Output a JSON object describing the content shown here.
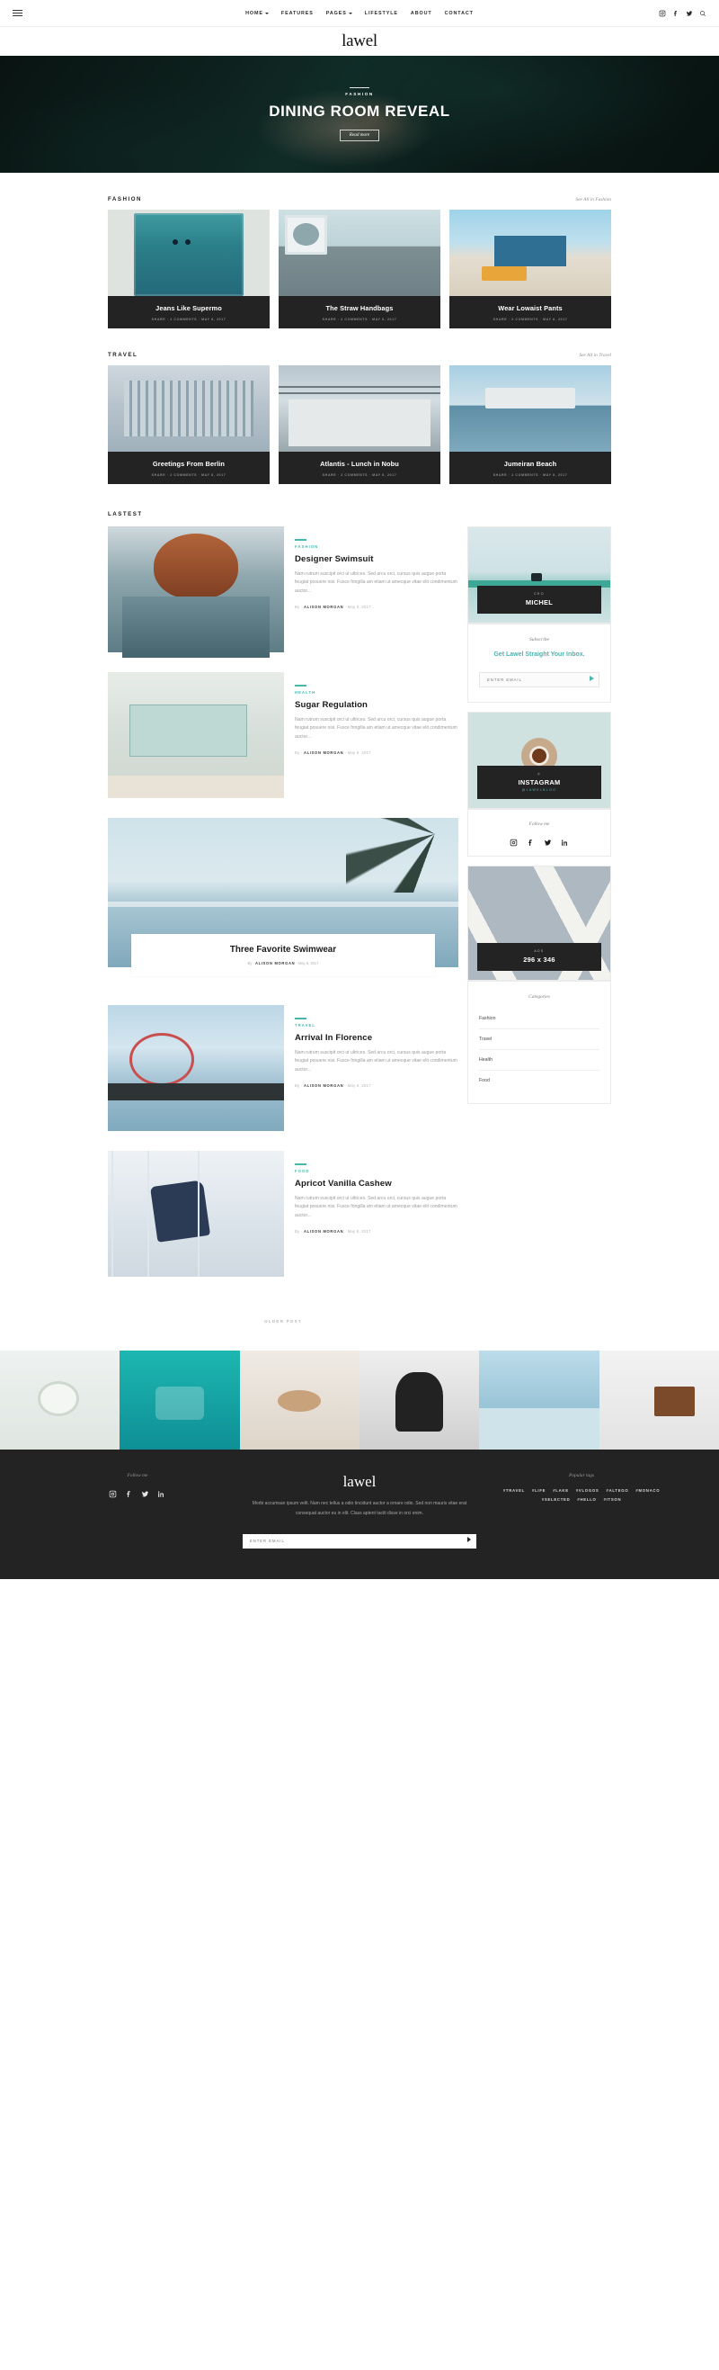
{
  "nav": {
    "menu_icon": "hamburger-icon",
    "items": [
      {
        "label": "HOME",
        "has_dropdown": true
      },
      {
        "label": "FEATURES",
        "has_dropdown": false
      },
      {
        "label": "PAGES",
        "has_dropdown": true
      },
      {
        "label": "LIFESTYLE",
        "has_dropdown": false
      },
      {
        "label": "ABOUT",
        "has_dropdown": false
      },
      {
        "label": "CONTACT",
        "has_dropdown": false
      }
    ],
    "social": [
      "instagram-icon",
      "facebook-icon",
      "twitter-icon",
      "search-icon"
    ]
  },
  "brand": {
    "name": "lawel"
  },
  "hero": {
    "category": "FASHION",
    "title": "DINING ROOM REVEAL",
    "button": "Read more"
  },
  "sections": [
    {
      "title": "FASHION",
      "see_all": "See All in Fashion",
      "cards": [
        {
          "title": "Jeans Like Supermo",
          "meta": "SHARE  ·  2 COMMENTS  ·  MAY 8, 2017",
          "img": "img-door"
        },
        {
          "title": "The Straw Handbags",
          "meta": "SHARE  ·  2 COMMENTS  ·  MAY 8, 2017",
          "img": "img-laundry"
        },
        {
          "title": "Wear Lowaist Pants",
          "meta": "SHARE  ·  2 COMMENTS  ·  MAY 8, 2017",
          "img": "img-beach"
        }
      ]
    },
    {
      "title": "TRAVEL",
      "see_all": "See All in Travel",
      "cards": [
        {
          "title": "Greetings From Berlin",
          "meta": "SHARE  ·  2 COMMENTS  ·  MAY 8, 2017",
          "img": "img-berlin"
        },
        {
          "title": "Atlantis - Lunch in Nobu",
          "meta": "SHARE  ·  2 COMMENTS  ·  MAY 8, 2017",
          "img": "img-nobu"
        },
        {
          "title": "Jumeiran Beach",
          "meta": "SHARE  ·  2 COMMENTS  ·  MAY 8, 2017",
          "img": "img-jumeiran"
        }
      ]
    }
  ],
  "latest": {
    "title": "LASTEST",
    "excerpt": "Nam rutrum suscipit orci ut ultrices. Sed arcu orci, cursus quis augue porta feugiat posuere nisi. Fusce fringilla am etiam ut amecque vitae elit condimentum auctor...",
    "by_prefix": "By",
    "posts": [
      {
        "category": "FASHION",
        "title": "Designer Swimsuit",
        "author": "ALISON MORGAN",
        "date": "May 8, 2017",
        "img": "img-hair"
      },
      {
        "category": "HEALTH",
        "title": "Sugar Regulation",
        "author": "ALISON MORGAN",
        "date": "May 8, 2017",
        "img": "img-lifeguard"
      }
    ],
    "feature": {
      "title": "Three Favorite Swimwear",
      "by_prefix": "By",
      "author": "ALISON MORGAN",
      "date": "May 8, 2017"
    },
    "posts2": [
      {
        "category": "TRAVEL",
        "title": "Arrival In Florence",
        "author": "ALISON MORGAN",
        "date": "May 8, 2017",
        "img": "img-pier"
      },
      {
        "category": "FOOD",
        "title": "Apricot Vanilla Cashew",
        "author": "ALISON MORGAN",
        "date": "May 8, 2017",
        "img": "img-jump"
      }
    ],
    "older_post": "OLDER POST"
  },
  "sidebar": {
    "ceo": {
      "kicker": "CEO",
      "name": "MICHEL"
    },
    "subscribe": {
      "heading": "Subscribe",
      "tagline": "Get Lawel Straight Your Inbox.",
      "placeholder": "ENTER EMAIL",
      "submit_icon": "arrow-right-icon"
    },
    "instagram": {
      "label": "INSTAGRAM",
      "handle": "@LAWELBLOG",
      "icon": "instagram-icon"
    },
    "follow": {
      "heading": "Follow me",
      "icons": [
        "instagram-icon",
        "facebook-icon",
        "twitter-icon",
        "linkedin-icon"
      ]
    },
    "ads": {
      "kicker": "ADS",
      "size": "296 x 346"
    },
    "categories": {
      "heading": "Categories",
      "items": [
        "Fashion",
        "Travel",
        "Health",
        "Food"
      ]
    }
  },
  "footer": {
    "follow_heading": "Follow me",
    "social": [
      "instagram-icon",
      "facebook-icon",
      "twitter-icon",
      "linkedin-icon"
    ],
    "brand": "lawel",
    "description": "Morbi accumsan ipsum velit. Nam nec tellus a odio tincidunt auctor a ornare odio. Sed non mauris vitae erat consequat auctor eu in elit. Class aptent taciti disse in orci enim.",
    "email_placeholder": "ENTER EMAIL",
    "submit_icon": "arrow-right-icon",
    "tags_heading": "Popular tags",
    "tags": [
      "#TRAVEL",
      "#LIFE",
      "#LAKE",
      "#VLOGOS",
      "#ALTEGO",
      "#MONACO",
      "#SELECTED",
      "#HELLO",
      "#ITSON"
    ]
  },
  "colors": {
    "accent": "#49b4b0",
    "dark": "#232323",
    "muted": "#9b9b9b"
  }
}
